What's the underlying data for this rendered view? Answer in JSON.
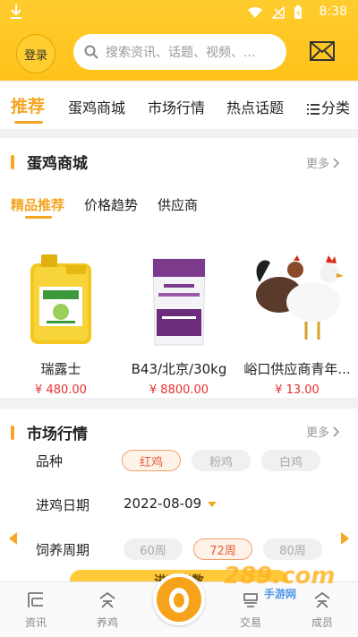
{
  "status": {
    "time": "8:38"
  },
  "header": {
    "login_label": "登录",
    "search_placeholder": "搜索资讯、话题、视频、..."
  },
  "tabs": [
    {
      "label": "推荐",
      "active": true
    },
    {
      "label": "蛋鸡商城",
      "active": false
    },
    {
      "label": "市场行情",
      "active": false
    },
    {
      "label": "热点话题",
      "active": false
    },
    {
      "label": "分类",
      "active": false
    }
  ],
  "mall": {
    "title": "蛋鸡商城",
    "more": "更多",
    "subtabs": [
      {
        "label": "精品推荐",
        "active": true
      },
      {
        "label": "价格趋势",
        "active": false
      },
      {
        "label": "供应商",
        "active": false
      }
    ],
    "products": [
      {
        "name": "瑞露士",
        "price": "¥ 480.00"
      },
      {
        "name": "B43/北京/30kg",
        "price": "¥ 8800.00"
      },
      {
        "name": "峪口供应商青年...",
        "price": "¥ 13.00"
      }
    ]
  },
  "market": {
    "title": "市场行情",
    "more": "更多",
    "breed_label": "品种",
    "breeds": [
      {
        "label": "红鸡",
        "active": true
      },
      {
        "label": "粉鸡",
        "active": false
      },
      {
        "label": "白鸡",
        "active": false
      }
    ],
    "date_label": "进鸡日期",
    "date_value": "2022-08-09",
    "period_label": "饲养周期",
    "periods": [
      {
        "label": "60周",
        "active": false
      },
      {
        "label": "72周",
        "active": true
      },
      {
        "label": "80周",
        "active": false
      }
    ],
    "index_button": "进鸡指数"
  },
  "bottom_nav": [
    {
      "label": "资讯",
      "icon": "news-icon"
    },
    {
      "label": "养鸡",
      "icon": "farm-icon"
    },
    {
      "label": "",
      "icon": "egg-center-icon"
    },
    {
      "label": "交易",
      "icon": "trade-icon"
    },
    {
      "label": "成员",
      "icon": "member-icon"
    }
  ],
  "watermark": {
    "main": "289.com",
    "sub": "手游网"
  },
  "colors": {
    "brand": "#ffc21a",
    "accent": "#f5a623",
    "price": "#e5322d"
  }
}
